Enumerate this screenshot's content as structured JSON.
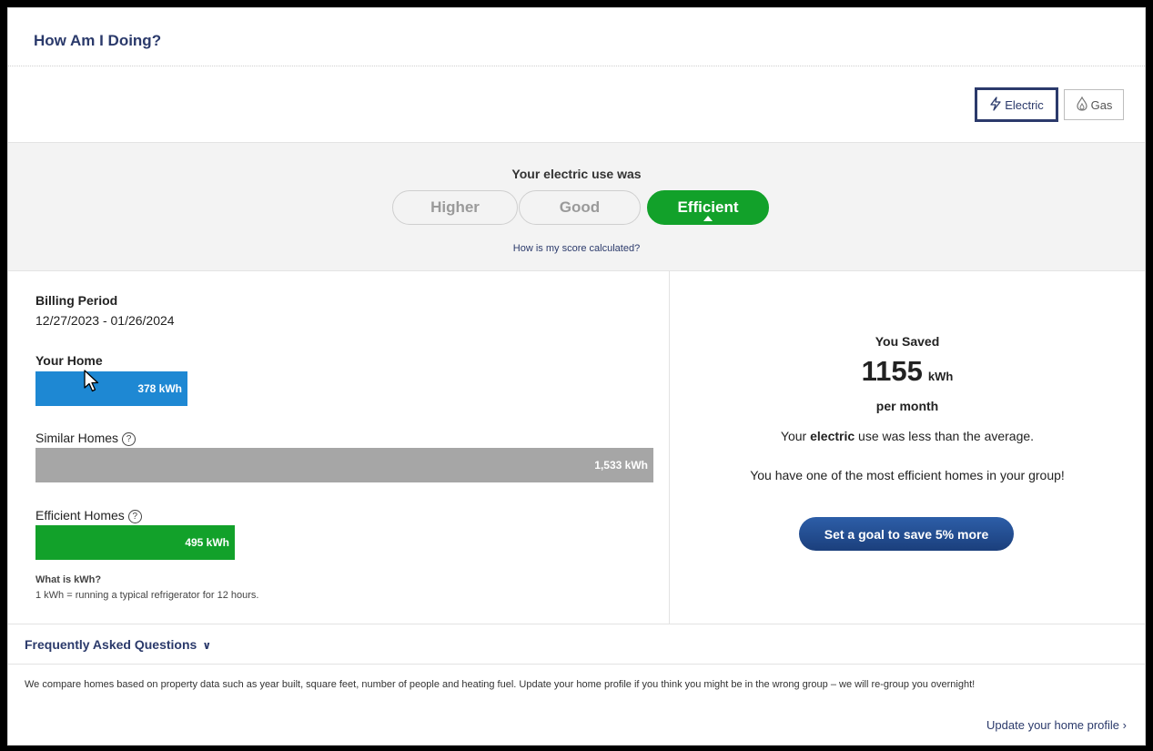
{
  "header": {
    "title": "How Am I Doing?"
  },
  "fuel_toggle": {
    "electric_label": "Electric",
    "electric_icon": "lightning-bolt-icon",
    "gas_label": "Gas",
    "gas_icon": "flame-icon",
    "selected": "Electric"
  },
  "score": {
    "title": "Your electric use was",
    "levels": [
      "Higher",
      "Good",
      "Efficient"
    ],
    "selected": "Efficient",
    "link": "How is my score calculated?"
  },
  "billing": {
    "label": "Billing Period",
    "period": "12/27/2023 - 01/26/2024"
  },
  "usage": [
    {
      "label": "Your Home",
      "value_text": "378 kWh",
      "value": 378
    },
    {
      "label": "Similar Homes",
      "value_text": "1,533 kWh",
      "value": 1533
    },
    {
      "label": "Efficient Homes",
      "value_text": "495 kWh",
      "value": 495
    }
  ],
  "kwh_info": {
    "question": "What is kWh?",
    "answer": "1 kWh = running a typical refrigerator for 12 hours."
  },
  "savings": {
    "title": "You Saved",
    "value": "1155",
    "unit": "kWh",
    "per": "per month",
    "msg_prefix": "Your ",
    "msg_bold": "electric",
    "msg_suffix": " use was less than the average.",
    "msg2": "You have one of the most efficient homes in your group!",
    "goal_button": "Set a goal to save 5% more"
  },
  "faq": {
    "title": "Frequently Asked Questions",
    "text": "We compare homes based on property data such as year built, square feet, number of people and heating fuel. Update your home profile if you think you might be in the wrong group – we will re-group you overnight!",
    "update_link": "Update your home profile"
  },
  "colors": {
    "brand_navy": "#2b3a6b",
    "efficient_green": "#12a12a",
    "home_blue": "#1e88d3",
    "similar_gray": "#a6a6a6"
  }
}
